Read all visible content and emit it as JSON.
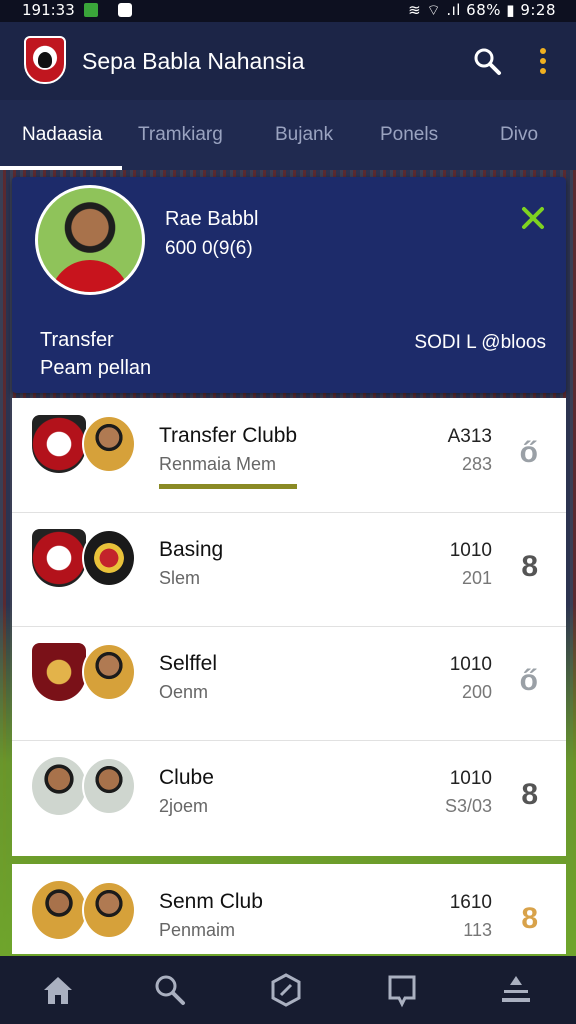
{
  "status_bar": {
    "time_left": "191:33",
    "right": "≋ ⌔ .ıl 68% ▮ 9:28"
  },
  "app": {
    "title": "Sepa Babla Nahansia"
  },
  "tabs": [
    "Nadaasia",
    "Tramkiarg",
    "Bujank",
    "Ponels",
    "Divo"
  ],
  "hero": {
    "name": "Rae Babbl",
    "sub": "600 0(9(6)",
    "left_line1": "Transfer",
    "left_line2": "Peam pellan",
    "right": "SODI L @bloos"
  },
  "rows": [
    {
      "title": "Transfer Clubb",
      "sub": "Renmaia Mem",
      "num1": "A313",
      "num2": "283",
      "badge": "ő",
      "progress": 0.8
    },
    {
      "title": "Basing",
      "sub": "Slem",
      "num1": "1010",
      "num2": "201",
      "badge": "8"
    },
    {
      "title": "Selffel",
      "sub": "Oenm",
      "num1": "1010",
      "num2": "200",
      "badge": "ő"
    },
    {
      "title": "Clube",
      "sub": "2joem",
      "num1": "1010",
      "num2": "S3/03",
      "badge": "8"
    },
    {
      "title": "Senm Club",
      "sub": "Penmaim",
      "num1": "1610",
      "num2": "113",
      "badge": "8"
    }
  ],
  "colors": {
    "accent": "#1d2b6a",
    "appbar": "#1c2547",
    "close": "#7ed321",
    "progress": "#8a8a25",
    "badge_gold": "#d8a24a"
  },
  "bottom_nav": [
    "home-icon",
    "search-icon",
    "compass-icon",
    "chat-icon",
    "profile-icon"
  ]
}
